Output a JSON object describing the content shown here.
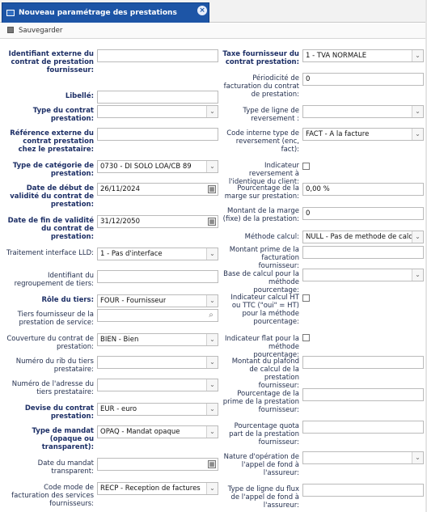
{
  "tab": {
    "title": "Nouveau paramétrage des prestations fournisseur",
    "close": "×"
  },
  "toolbar": {
    "save_label": "Sauvegarder"
  },
  "left": [
    {
      "label": "Identifiant externe du contrat de prestation fournisseur:",
      "value": "",
      "bold": true
    },
    {
      "label": "Libellé:",
      "value": "",
      "bold": true
    },
    {
      "label": "Type du contrat prestation:",
      "value": "",
      "bold": true
    },
    {
      "label": "Référence externe du contrat prestation chez le prestataire:",
      "value": "",
      "bold": true
    },
    {
      "label": "Type de catégorie de prestation:",
      "value": "0730 - DI SOLO LOA/CB 89",
      "bold": true
    },
    {
      "label": "Date de début de validité du contrat de prestation:",
      "value": "26/11/2024",
      "bold": true
    },
    {
      "label": "Date de fin de validité du contrat de prestation:",
      "value": "31/12/2050",
      "bold": true
    },
    {
      "label": "Traitement interface LLD:",
      "value": "1 - Pas d'interface",
      "bold": false
    },
    {
      "label": "Identifiant du regroupement de tiers:",
      "value": "",
      "bold": false
    },
    {
      "label": "Rôle du tiers:",
      "value": "FOUR - Fournisseur",
      "bold": true
    },
    {
      "label": "Tiers fournisseur de la prestation de service:",
      "value": "",
      "bold": false
    },
    {
      "label": "Couverture du contrat de prestation:",
      "value": "BIEN - Bien",
      "bold": false
    },
    {
      "label": "Numéro du rib du tiers prestataire:",
      "value": "",
      "bold": false
    },
    {
      "label": "Numéro de l'adresse du tiers prestataire:",
      "value": "",
      "bold": false
    },
    {
      "label": "Devise du contrat prestation:",
      "value": "EUR - euro",
      "bold": true
    },
    {
      "label": "Type de mandat (opaque ou transparent):",
      "value": "OPAQ - Mandat opaque",
      "bold": true
    },
    {
      "label": "Date du mandat transparent:",
      "value": "",
      "bold": false
    },
    {
      "label": "Code mode de facturation des services fournisseurs:",
      "value": "RECP - Reception de factures",
      "bold": false
    }
  ],
  "right": [
    {
      "label": "Taxe fournisseur du contrat prestation:",
      "value": "1 - TVA NORMALE",
      "bold": true
    },
    {
      "label": "Périodicité de facturation du contrat de prestation:",
      "value": "0",
      "bold": false
    },
    {
      "label": "Type de ligne de reversement :",
      "value": "",
      "bold": false
    },
    {
      "label": "Code interne type de reversement (enc, fact):",
      "value": "FACT - A la facture",
      "bold": false
    },
    {
      "label": "Indicateur reversement à l'identique du client:",
      "value": "",
      "bold": false
    },
    {
      "label": "Pourcentage de la marge sur prestation:",
      "value": "0,00 %",
      "bold": false
    },
    {
      "label": "Montant de la marge (fixe) de la prestation:",
      "value": "0",
      "bold": false
    },
    {
      "label": "Méthode calcul:",
      "value": "NULL - Pas de methode de calcul",
      "bold": false
    },
    {
      "label": "Montant prime de la facturation fournisseur:",
      "value": "",
      "bold": false
    },
    {
      "label": "Base de calcul pour la méthode pourcentage:",
      "value": "",
      "bold": false
    },
    {
      "label": "Indicateur calcul HT ou TTC (\"oui\" = HT) pour la méthode pourcentage:",
      "value": "",
      "bold": false
    },
    {
      "label": "Indicateur flat pour la méthode pourcentage:",
      "value": "",
      "bold": false
    },
    {
      "label": "Montant du plafond de calcul de la prestation fournisseur:",
      "value": "",
      "bold": false
    },
    {
      "label": "Pourcentage de la prime de la prestation fournisseur:",
      "value": "",
      "bold": false
    },
    {
      "label": "Pourcentage quota part de la prestation fournisseur:",
      "value": "",
      "bold": false
    },
    {
      "label": "Nature d'opération de l'appel de fond à l'assureur:",
      "value": "",
      "bold": false
    },
    {
      "label": "Type de ligne du flux de l'appel de fond à l'assureur:",
      "value": "",
      "bold": false
    }
  ],
  "icons": {
    "select": "chevron-down-icon",
    "calendar": "calendar-icon",
    "search": "search-icon",
    "save": "save-icon"
  }
}
